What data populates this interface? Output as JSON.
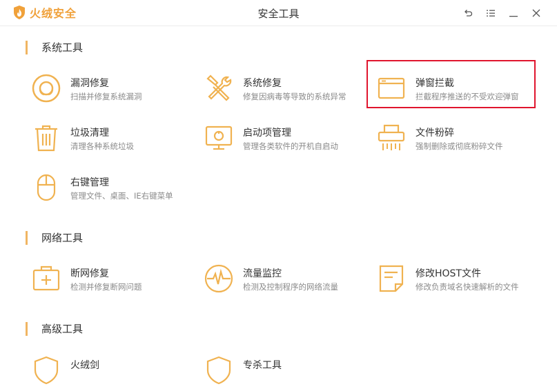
{
  "app": {
    "name": "火绒安全",
    "window_title": "安全工具"
  },
  "sections": [
    {
      "title": "系统工具",
      "tools": [
        {
          "name": "漏洞修复",
          "desc": "扫描并修复系统漏洞",
          "icon": "vulnerability-repair-icon"
        },
        {
          "name": "系统修复",
          "desc": "修复因病毒等导致的系统异常",
          "icon": "wrench-screwdriver-icon"
        },
        {
          "name": "弹窗拦截",
          "desc": "拦截程序推送的不受欢迎弹窗",
          "icon": "popup-window-icon"
        },
        {
          "name": "垃圾清理",
          "desc": "清理各种系统垃圾",
          "icon": "trash-can-icon"
        },
        {
          "name": "启动项管理",
          "desc": "管理各类软件的开机自启动",
          "icon": "monitor-startup-icon"
        },
        {
          "name": "文件粉碎",
          "desc": "强制删除或彻底粉碎文件",
          "icon": "shredder-icon"
        },
        {
          "name": "右键管理",
          "desc": "管理文件、桌面、IE右键菜单",
          "icon": "mouse-icon"
        }
      ]
    },
    {
      "title": "网络工具",
      "tools": [
        {
          "name": "断网修复",
          "desc": "检测并修复断网问题",
          "icon": "first-aid-kit-icon"
        },
        {
          "name": "流量监控",
          "desc": "检测及控制程序的网络流量",
          "icon": "traffic-wave-icon"
        },
        {
          "name": "修改HOST文件",
          "desc": "修改负责域名快速解析的文件",
          "icon": "host-file-icon"
        }
      ]
    },
    {
      "title": "高级工具",
      "tools": [
        {
          "name": "火绒剑",
          "desc": "",
          "icon": "shield-icon"
        },
        {
          "name": "专杀工具",
          "desc": "",
          "icon": "shield-icon"
        }
      ]
    }
  ],
  "highlighted_tool": "弹窗拦截",
  "colors": {
    "accent": "#f0a13a",
    "icon": "#f0b250",
    "highlight": "#e0142d"
  }
}
